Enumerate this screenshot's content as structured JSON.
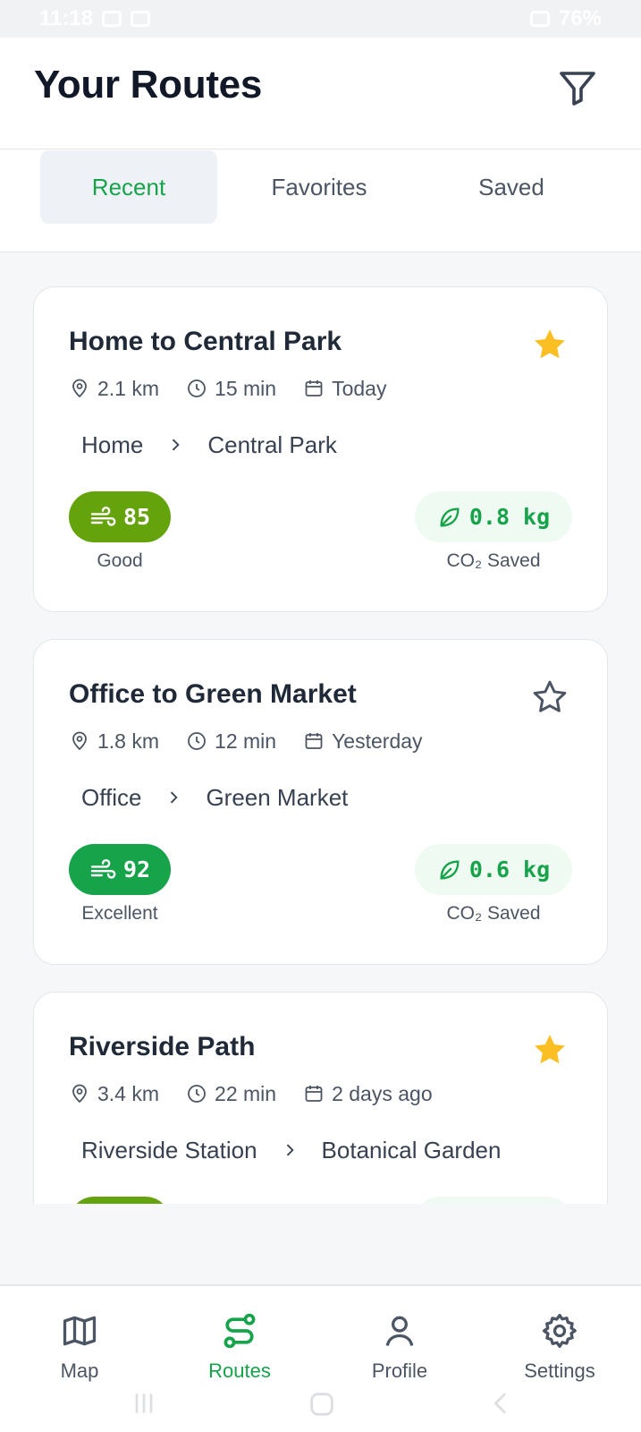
{
  "status_bar": {
    "time": "11:18",
    "battery": "76%"
  },
  "header": {
    "title": "Your Routes",
    "filter_icon": "filter-icon"
  },
  "tabs": [
    {
      "label": "Recent",
      "active": true
    },
    {
      "label": "Favorites",
      "active": false
    },
    {
      "label": "Saved",
      "active": false
    }
  ],
  "routes": [
    {
      "title": "Home to Central Park",
      "favorite": true,
      "distance": "2.1 km",
      "duration": "15 min",
      "date": "Today",
      "from": "Home",
      "to": "Central Park",
      "aqi": "85",
      "aqi_label": "Good",
      "aqi_color": "#65a30d",
      "co2": "0.8 kg",
      "co2_label": "CO₂ Saved"
    },
    {
      "title": "Office to Green Market",
      "favorite": false,
      "distance": "1.8 km",
      "duration": "12 min",
      "date": "Yesterday",
      "from": "Office",
      "to": "Green Market",
      "aqi": "92",
      "aqi_label": "Excellent",
      "aqi_color": "#16a34a",
      "co2": "0.6 kg",
      "co2_label": "CO₂ Saved"
    },
    {
      "title": "Riverside Path",
      "favorite": true,
      "distance": "3.4 km",
      "duration": "22 min",
      "date": "2 days ago",
      "from": "Riverside Station",
      "to": "Botanical Garden",
      "aqi_color": "#65a30d"
    }
  ],
  "bottom_nav": [
    {
      "label": "Map",
      "icon": "map-icon",
      "active": false
    },
    {
      "label": "Routes",
      "icon": "routes-icon",
      "active": true
    },
    {
      "label": "Profile",
      "icon": "profile-icon",
      "active": false
    },
    {
      "label": "Settings",
      "icon": "settings-icon",
      "active": false
    }
  ],
  "colors": {
    "accent": "#16a34a",
    "star": "#fbbf24",
    "aqi_good": "#65a30d",
    "aqi_excellent": "#16a34a"
  }
}
